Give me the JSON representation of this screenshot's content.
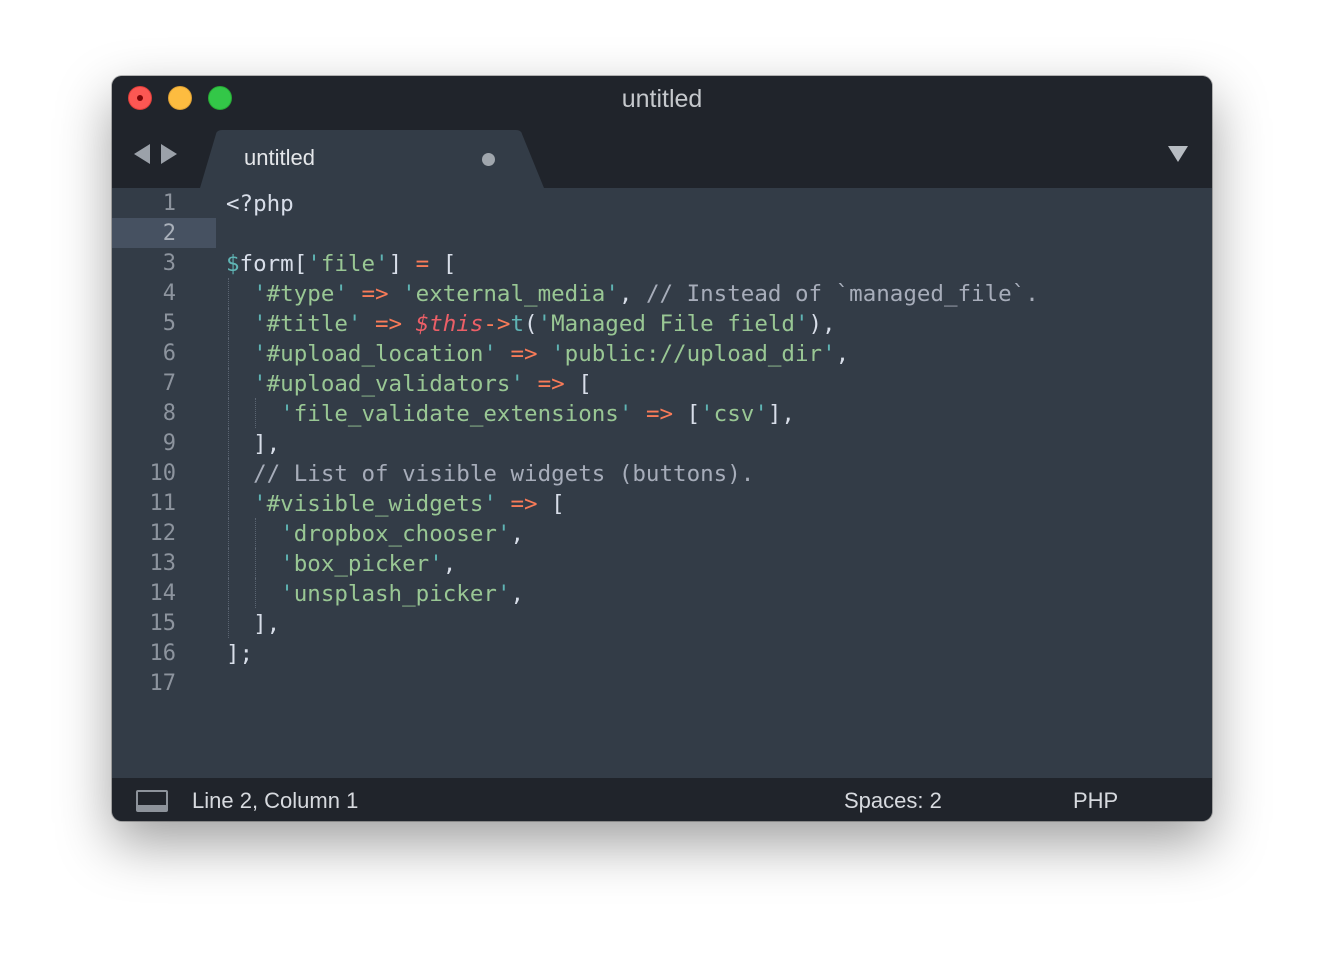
{
  "window": {
    "title": "untitled"
  },
  "tab": {
    "label": "untitled",
    "dirty": true
  },
  "editor": {
    "current_line": 2,
    "lines": [
      {
        "number": "1",
        "tokens": [
          [
            "def",
            "<?php"
          ]
        ]
      },
      {
        "number": "2",
        "tokens": []
      },
      {
        "number": "3",
        "tokens": [
          [
            "var",
            "$"
          ],
          [
            "def",
            "form["
          ],
          [
            "qt",
            "'"
          ],
          [
            "str",
            "file"
          ],
          [
            "qt",
            "'"
          ],
          [
            "def",
            "] "
          ],
          [
            "op",
            "="
          ],
          [
            "def",
            " ["
          ]
        ]
      },
      {
        "number": "4",
        "tokens": [
          [
            "def",
            "  "
          ],
          [
            "qt",
            "'"
          ],
          [
            "str",
            "#type"
          ],
          [
            "qt",
            "'"
          ],
          [
            "def",
            " "
          ],
          [
            "op",
            "=>"
          ],
          [
            "def",
            " "
          ],
          [
            "qt",
            "'"
          ],
          [
            "str",
            "external_media"
          ],
          [
            "qt",
            "'"
          ],
          [
            "def",
            ", "
          ],
          [
            "cmt",
            "// Instead of `managed_file`."
          ]
        ]
      },
      {
        "number": "5",
        "tokens": [
          [
            "def",
            "  "
          ],
          [
            "qt",
            "'"
          ],
          [
            "str",
            "#title"
          ],
          [
            "qt",
            "'"
          ],
          [
            "def",
            " "
          ],
          [
            "op",
            "=>"
          ],
          [
            "def",
            " "
          ],
          [
            "this",
            "$this"
          ],
          [
            "op",
            "->"
          ],
          [
            "fn",
            "t"
          ],
          [
            "def",
            "("
          ],
          [
            "qt",
            "'"
          ],
          [
            "str",
            "Managed File field"
          ],
          [
            "qt",
            "'"
          ],
          [
            "def",
            "),"
          ]
        ]
      },
      {
        "number": "6",
        "tokens": [
          [
            "def",
            "  "
          ],
          [
            "qt",
            "'"
          ],
          [
            "str",
            "#upload_location"
          ],
          [
            "qt",
            "'"
          ],
          [
            "def",
            " "
          ],
          [
            "op",
            "=>"
          ],
          [
            "def",
            " "
          ],
          [
            "qt",
            "'"
          ],
          [
            "str",
            "public://upload_dir"
          ],
          [
            "qt",
            "'"
          ],
          [
            "def",
            ","
          ]
        ]
      },
      {
        "number": "7",
        "tokens": [
          [
            "def",
            "  "
          ],
          [
            "qt",
            "'"
          ],
          [
            "str",
            "#upload_validators"
          ],
          [
            "qt",
            "'"
          ],
          [
            "def",
            " "
          ],
          [
            "op",
            "=>"
          ],
          [
            "def",
            " ["
          ]
        ]
      },
      {
        "number": "8",
        "tokens": [
          [
            "def",
            "    "
          ],
          [
            "qt",
            "'"
          ],
          [
            "str",
            "file_validate_extensions"
          ],
          [
            "qt",
            "'"
          ],
          [
            "def",
            " "
          ],
          [
            "op",
            "=>"
          ],
          [
            "def",
            " ["
          ],
          [
            "qt",
            "'"
          ],
          [
            "str",
            "csv"
          ],
          [
            "qt",
            "'"
          ],
          [
            "def",
            "],"
          ]
        ]
      },
      {
        "number": "9",
        "tokens": [
          [
            "def",
            "  ],"
          ]
        ]
      },
      {
        "number": "10",
        "tokens": [
          [
            "def",
            "  "
          ],
          [
            "cmt",
            "// List of visible widgets (buttons)."
          ]
        ]
      },
      {
        "number": "11",
        "tokens": [
          [
            "def",
            "  "
          ],
          [
            "qt",
            "'"
          ],
          [
            "str",
            "#visible_widgets"
          ],
          [
            "qt",
            "'"
          ],
          [
            "def",
            " "
          ],
          [
            "op",
            "=>"
          ],
          [
            "def",
            " ["
          ]
        ]
      },
      {
        "number": "12",
        "tokens": [
          [
            "def",
            "    "
          ],
          [
            "qt",
            "'"
          ],
          [
            "str",
            "dropbox_chooser"
          ],
          [
            "qt",
            "'"
          ],
          [
            "def",
            ","
          ]
        ]
      },
      {
        "number": "13",
        "tokens": [
          [
            "def",
            "    "
          ],
          [
            "qt",
            "'"
          ],
          [
            "str",
            "box_picker"
          ],
          [
            "qt",
            "'"
          ],
          [
            "def",
            ","
          ]
        ]
      },
      {
        "number": "14",
        "tokens": [
          [
            "def",
            "    "
          ],
          [
            "qt",
            "'"
          ],
          [
            "str",
            "unsplash_picker"
          ],
          [
            "qt",
            "'"
          ],
          [
            "def",
            ","
          ]
        ]
      },
      {
        "number": "15",
        "tokens": [
          [
            "def",
            "  ],"
          ]
        ]
      },
      {
        "number": "16",
        "tokens": [
          [
            "def",
            "];"
          ]
        ]
      },
      {
        "number": "17",
        "tokens": []
      }
    ]
  },
  "status": {
    "position": "Line 2, Column 1",
    "indentation": "Spaces: 2",
    "syntax": "PHP"
  },
  "icons": {
    "close": "close-button",
    "minimize": "minimize-button",
    "zoom": "zoom-button",
    "back": "back-arrow-icon",
    "forward": "forward-arrow-icon",
    "tab_menu": "tab-menu-triangle-icon",
    "panel": "panel-toggle-icon"
  },
  "colors": {
    "window_bg": "#333c47",
    "chrome_bg": "#20242b",
    "string": "#99c794",
    "variable": "#5fb4b4",
    "operator": "#f97b58",
    "comment": "#a7adba",
    "this_keyword": "#ec5f67"
  }
}
